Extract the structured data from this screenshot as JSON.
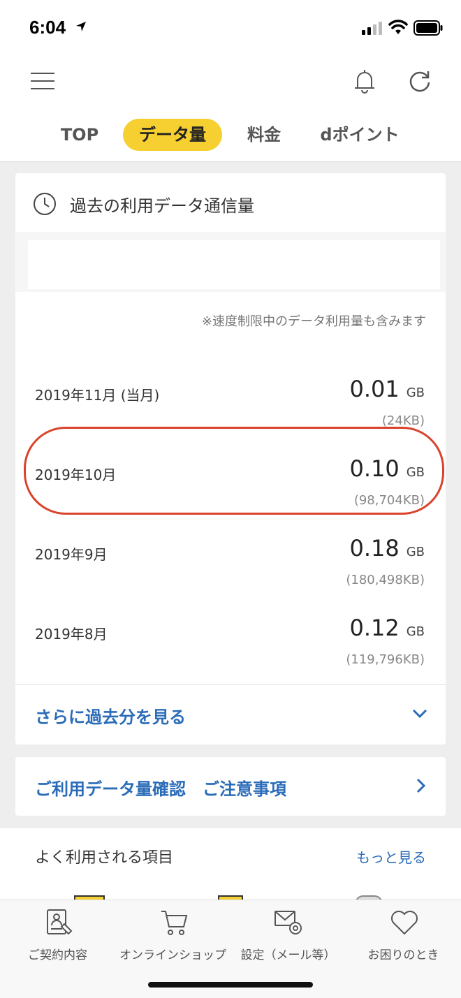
{
  "status_bar": {
    "time": "6:04"
  },
  "tabs": [
    {
      "label": "TOP",
      "active": false
    },
    {
      "label": "データ量",
      "active": true
    },
    {
      "label": "料金",
      "active": false
    },
    {
      "label": "dポイント",
      "active": false
    }
  ],
  "history": {
    "title": "過去の利用データ通信量",
    "note": "※速度制限中のデータ利用量も含みます",
    "rows": [
      {
        "month": "2019年11月 (当月)",
        "gb": "0.01",
        "unit": "GB",
        "kb": "(24KB)",
        "highlighted": false
      },
      {
        "month": "2019年10月",
        "gb": "0.10",
        "unit": "GB",
        "kb": "(98,704KB)",
        "highlighted": true
      },
      {
        "month": "2019年9月",
        "gb": "0.18",
        "unit": "GB",
        "kb": "(180,498KB)",
        "highlighted": false
      },
      {
        "month": "2019年8月",
        "gb": "0.12",
        "unit": "GB",
        "kb": "(119,796KB)",
        "highlighted": false
      }
    ],
    "more_label": "さらに過去分を見る"
  },
  "confirm_link": "ご利用データ量確認　ご注意事項",
  "frequent": {
    "title": "よく利用される項目",
    "more": "もっと見る"
  },
  "tabbar": [
    {
      "label": "ご契約内容",
      "icon": "contract-icon"
    },
    {
      "label": "オンラインショップ",
      "icon": "cart-icon"
    },
    {
      "label": "設定（メール等）",
      "icon": "mail-settings-icon"
    },
    {
      "label": "お困りのとき",
      "icon": "heart-icon"
    }
  ],
  "colors": {
    "accent_yellow": "#f5d030",
    "link_blue": "#2b6cb8",
    "highlight_red": "#d9432b"
  }
}
